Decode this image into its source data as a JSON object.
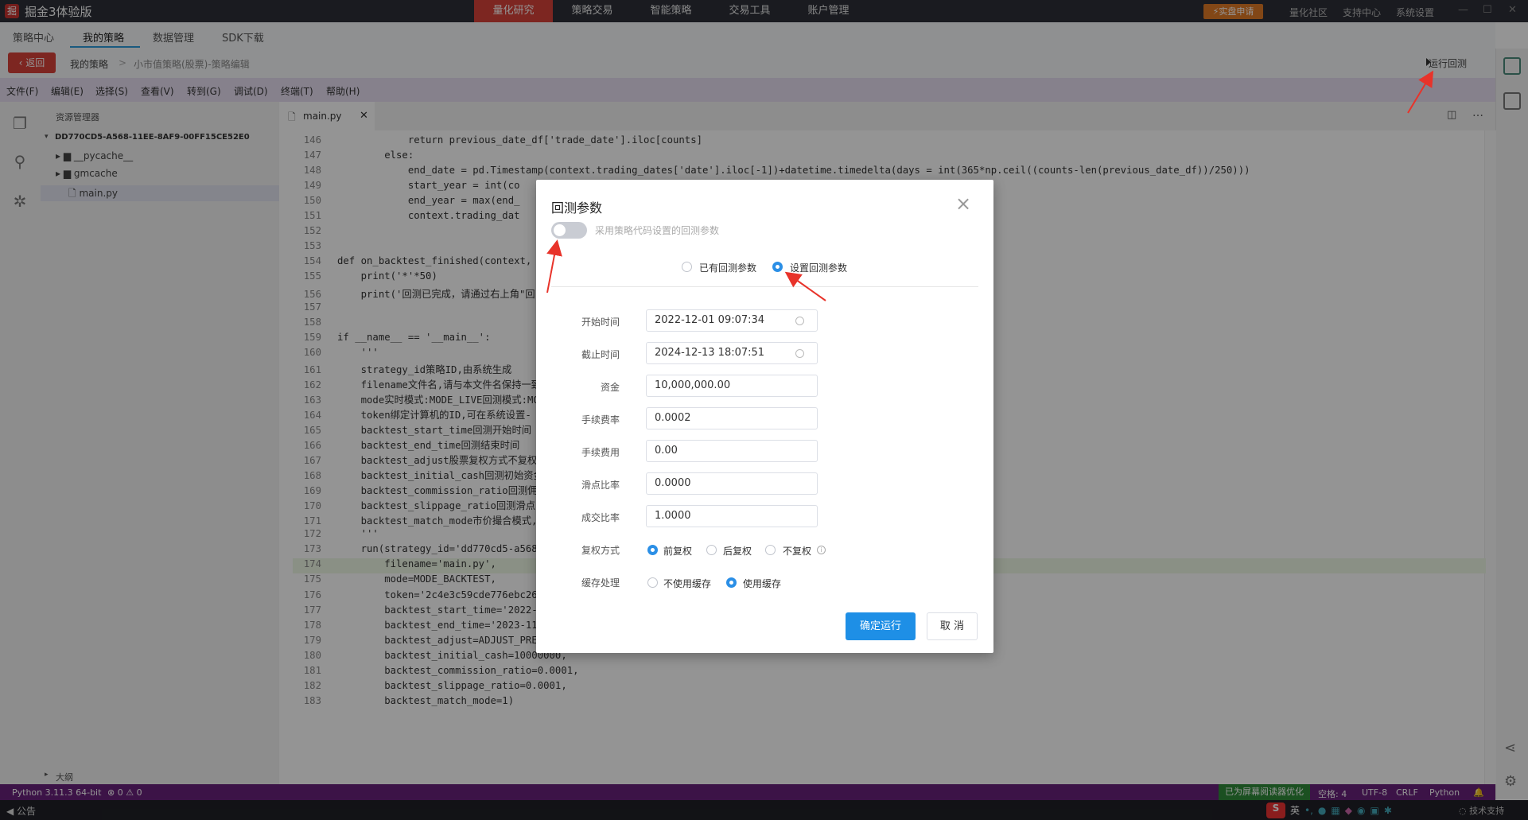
{
  "app": {
    "logo": "掘",
    "title": "掘金3体验版"
  },
  "topnav": {
    "items": [
      "量化研究",
      "策略交易",
      "智能策略",
      "交易工具",
      "账户管理"
    ],
    "active_index": 0,
    "live_button": "⚡实盘申请",
    "links": [
      "量化社区",
      "支持中心",
      "系统设置"
    ]
  },
  "subtabs": {
    "items": [
      "策略中心",
      "我的策略",
      "数据管理",
      "SDK下载"
    ],
    "active_index": 1
  },
  "breadcrumb": {
    "back": "返回",
    "path": [
      "我的策略",
      "小市值策略(股票)-策略编辑"
    ],
    "separator": ">",
    "run_backtest": "运行回测"
  },
  "menubar": [
    "文件(F)",
    "编辑(E)",
    "选择(S)",
    "查看(V)",
    "转到(G)",
    "调试(D)",
    "终端(T)",
    "帮助(H)"
  ],
  "explorer": {
    "title": "资源管理器",
    "root": "DD770CD5-A568-11EE-8AF9-00FF15CE52E0",
    "items": [
      {
        "name": "__pycache__",
        "type": "folder"
      },
      {
        "name": "gmcache",
        "type": "folder"
      },
      {
        "name": "main.py",
        "type": "file",
        "selected": true
      }
    ],
    "outline": "大纲"
  },
  "editor": {
    "tab": "main.py",
    "highlight_line": 174,
    "lines": [
      {
        "n": 146,
        "code": "            return previous_date_df['trade_date'].iloc[counts]"
      },
      {
        "n": 147,
        "code": "        else:"
      },
      {
        "n": 148,
        "code": "            end_date = pd.Timestamp(context.trading_dates['date'].iloc[-1])+datetime.timedelta(days = int(365*np.ceil((counts-len(previous_date_df))/250)))"
      },
      {
        "n": 149,
        "code": "            start_year = int(co"
      },
      {
        "n": 150,
        "code": "            end_year = max(end_"
      },
      {
        "n": 151,
        "code": "            context.trading_dat                                                    d_year=end_year)"
      },
      {
        "n": 152,
        "code": ""
      },
      {
        "n": 153,
        "code": ""
      },
      {
        "n": 154,
        "code": "def on_backtest_finished(context, i"
      },
      {
        "n": 155,
        "code": "    print('*'*50)"
      },
      {
        "n": 156,
        "code": "    print('回测已完成，请通过右上角\"回"
      },
      {
        "n": 157,
        "code": ""
      },
      {
        "n": 158,
        "code": ""
      },
      {
        "n": 159,
        "code": "if __name__ == '__main__':"
      },
      {
        "n": 160,
        "code": "    '''"
      },
      {
        "n": 161,
        "code": "    strategy_id策略ID,由系统生成"
      },
      {
        "n": 162,
        "code": "    filename文件名,请与本文件名保持一致"
      },
      {
        "n": 163,
        "code": "    mode实时模式:MODE_LIVE回测模式:MO"
      },
      {
        "n": 164,
        "code": "    token绑定计算机的ID,可在系统设置-"
      },
      {
        "n": 165,
        "code": "    backtest_start_time回测开始时间"
      },
      {
        "n": 166,
        "code": "    backtest_end_time回测结束时间"
      },
      {
        "n": 167,
        "code": "    backtest_adjust股票复权方式不复权"
      },
      {
        "n": 168,
        "code": "    backtest_initial_cash回测初始资金"
      },
      {
        "n": 169,
        "code": "    backtest_commission_ratio回测佣金"
      },
      {
        "n": 170,
        "code": "    backtest_slippage_ratio回测滑点比"
      },
      {
        "n": 171,
        "code": "    backtest_match_mode市价撮合模式,"
      },
      {
        "n": 172,
        "code": "    '''"
      },
      {
        "n": 173,
        "code": "    run(strategy_id='dd770cd5-a568-"
      },
      {
        "n": 174,
        "code": "        filename='main.py',"
      },
      {
        "n": 175,
        "code": "        mode=MODE_BACKTEST,"
      },
      {
        "n": 176,
        "code": "        token='2c4e3c59cde776ebc268"
      },
      {
        "n": 177,
        "code": "        backtest_start_time='2022-1"
      },
      {
        "n": 178,
        "code": "        backtest_end_time='2023-11-"
      },
      {
        "n": 179,
        "code": "        backtest_adjust=ADJUST_PREV"
      },
      {
        "n": 180,
        "code": "        backtest_initial_cash=10000000,"
      },
      {
        "n": 181,
        "code": "        backtest_commission_ratio=0.0001,"
      },
      {
        "n": 182,
        "code": "        backtest_slippage_ratio=0.0001,"
      },
      {
        "n": 183,
        "code": "        backtest_match_mode=1)"
      }
    ]
  },
  "statusbar": {
    "python": "Python 3.11.3 64-bit",
    "errors": "⊗ 0 ⚠ 0",
    "screen_reader": "已为屏幕阅读器优化",
    "spaces": "空格: 4",
    "encoding": "UTF-8",
    "eol": "CRLF",
    "language": "Python"
  },
  "bottombar": {
    "notice": "公告",
    "tech_support": "技术支持"
  },
  "dialog": {
    "title": "回测参数",
    "close": "×",
    "toggle_label": "采用策略代码设置的回测参数",
    "toggle_on": false,
    "mode_options": [
      "已有回测参数",
      "设置回测参数"
    ],
    "mode_selected": 1,
    "fields": [
      {
        "label": "开始时间",
        "value": "2022-12-01 09:07:34",
        "icon": "clock-icon"
      },
      {
        "label": "截止时间",
        "value": "2024-12-13 18:07:51",
        "icon": "clock-icon"
      },
      {
        "label": "资金",
        "value": "10,000,000.00"
      },
      {
        "label": "手续费率",
        "value": "0.0002"
      },
      {
        "label": "手续费用",
        "value": "0.00"
      },
      {
        "label": "滑点比率",
        "value": "0.0000"
      },
      {
        "label": "成交比率",
        "value": "1.0000"
      }
    ],
    "adjust": {
      "label": "复权方式",
      "options": [
        "前复权",
        "后复权",
        "不复权"
      ],
      "selected": 0
    },
    "cache": {
      "label": "缓存处理",
      "options": [
        "不使用缓存",
        "使用缓存"
      ],
      "selected": 1
    },
    "confirm": "确定运行",
    "cancel": "取 消"
  },
  "colors": {
    "accent_red": "#d8423a",
    "primary_blue": "#1e8fe6",
    "menubar_purple": "#e7dff2",
    "statusbar_purple": "#68217a",
    "annotation_red": "#e8332a"
  }
}
